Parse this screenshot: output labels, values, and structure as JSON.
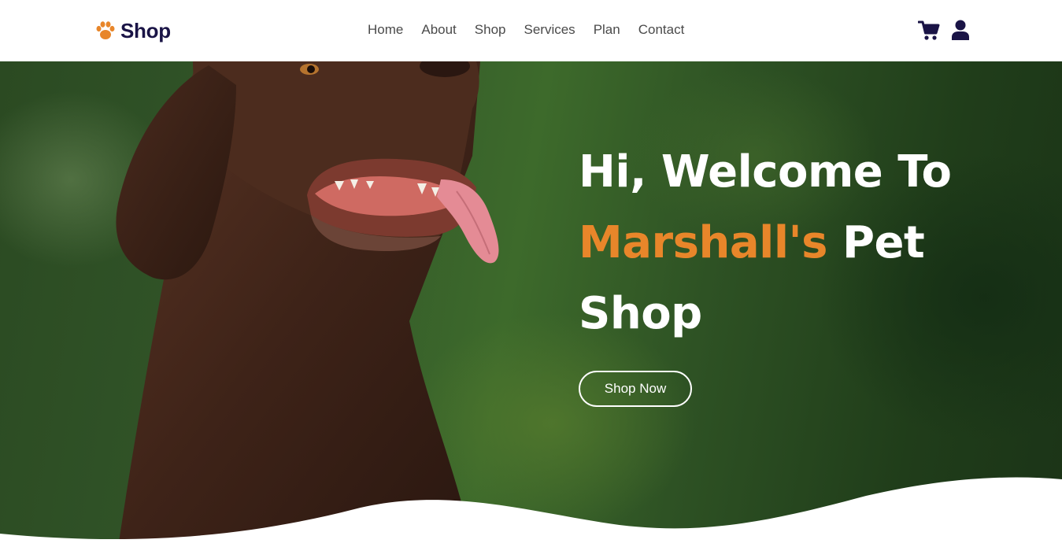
{
  "colors": {
    "brand_dark": "#1a1446",
    "accent": "#e8862a",
    "nav_text": "#4a4a4a"
  },
  "header": {
    "logo_icon": "paw-icon",
    "brand": "Shop",
    "nav": [
      {
        "label": "Home"
      },
      {
        "label": "About"
      },
      {
        "label": "Shop"
      },
      {
        "label": "Services"
      },
      {
        "label": "Plan"
      },
      {
        "label": "Contact"
      }
    ],
    "icons": [
      "cart-icon",
      "user-icon"
    ]
  },
  "hero": {
    "line1": "Hi, Welcome To",
    "highlight": "Marshall's",
    "line2_rest": "Pet",
    "line3": "Shop",
    "cta": "Shop Now",
    "image": "chocolate-labrador-dog"
  }
}
